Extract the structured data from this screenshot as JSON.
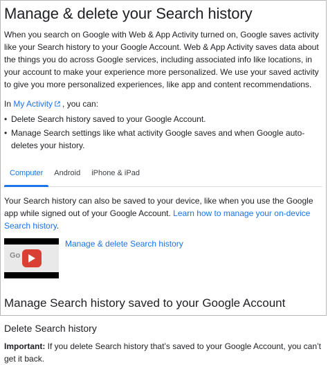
{
  "title": "Manage & delete your Search history",
  "intro": "When you search on Google with Web & App Activity turned on, Google saves activity like your Search history to your Google Account. Web & App Activity saves data about the things you do across Google services, including associated info like locations, in your account to make your experience more personalized. We use your saved activity to give you more personalized experiences, like app and content recommendations.",
  "lead": {
    "prefix": "In",
    "link": "My Activity",
    "suffix": ", you can:"
  },
  "bullets": [
    "Delete Search history saved to your Google Account.",
    "Manage Search settings like what activity Google saves and when Google auto-deletes your history."
  ],
  "tabs": [
    {
      "label": "Computer",
      "active": true
    },
    {
      "label": "Android",
      "active": false
    },
    {
      "label": "iPhone & iPad",
      "active": false
    }
  ],
  "tab_content": {
    "text": "Your Search history can also be saved to your device, like when you use the Google app while signed out of your Google Account.",
    "link": "Learn how to manage your on-device Search history",
    "end": "."
  },
  "video": {
    "thumb_text": "Go",
    "link": "Manage & delete Search history"
  },
  "section_heading": "Manage Search history saved to your Google Account",
  "sub_heading": "Delete Search history",
  "important": {
    "label": "Important:",
    "text": "If you delete Search history that’s saved to your Google Account, you can’t get it back."
  },
  "colors": {
    "link": "#1a73e8",
    "text": "#202124",
    "play": "#d93f33"
  }
}
